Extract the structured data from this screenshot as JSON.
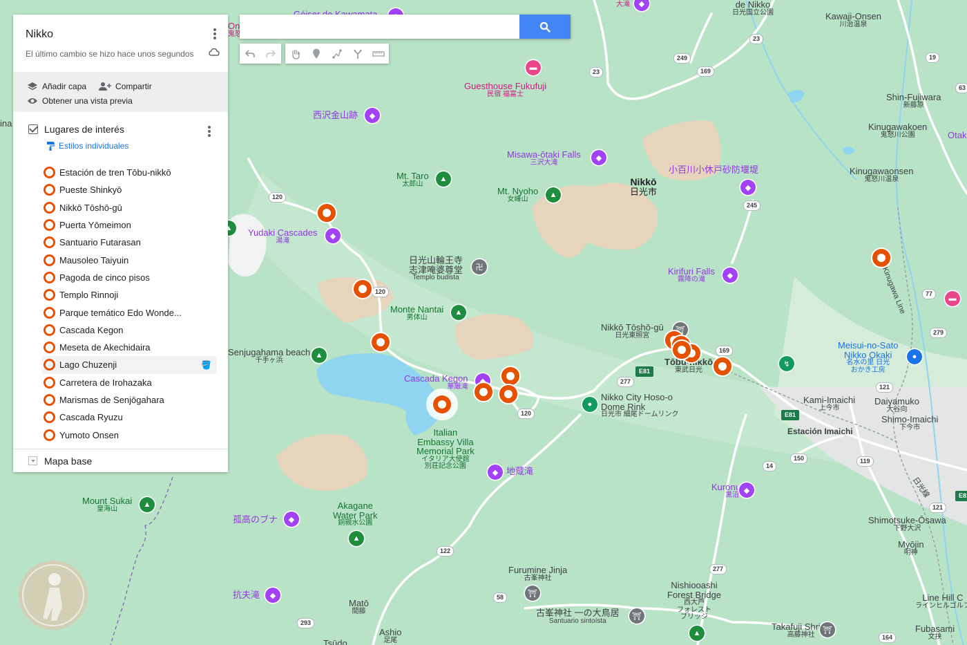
{
  "search": {
    "placeholder": ""
  },
  "toolbar": {
    "icons": [
      "undo-icon",
      "redo-icon",
      "hand-icon",
      "marker-icon",
      "polyline-icon",
      "directions-icon",
      "ruler-icon"
    ]
  },
  "panel": {
    "title": "Nikko",
    "subtitle": "El último cambio se hizo hace unos segundos",
    "add_layer": "Añadir capa",
    "share": "Compartir",
    "preview": "Obtener una vista previa",
    "layer_title": "Lugares de interés",
    "style_link": "Estilos individuales",
    "items": [
      "Estación de tren Tōbu-nikkō",
      "Pueste Shinkyō",
      "Nikkō Tōshō-gū",
      "Puerta Yōmeimon",
      "Santuario Futarasan",
      "Mausoleo Taiyuin",
      "Pagoda de cinco pisos",
      "Templo Rinnoji",
      "Parque temático Edo Wonde...",
      "Cascada Kegon",
      "Meseta de Akechidaira",
      "Lago Chuzenji",
      "Carretera de Irohazaka",
      "Marismas de Senjōgahara",
      "Cascada Ryuzu",
      "Yumoto Onsen"
    ],
    "selected_index": 11,
    "basemap": "Mapa base"
  },
  "map": {
    "labels": {
      "geyser": "Géiser de Kawamata",
      "onsen_top": "Onsen",
      "onsen_top_sub": "鬼怒",
      "nikko_park": "de Nikko",
      "nikko_park_sub": "日光国立公園",
      "kawaji": "Kawaji-Onsen",
      "kawaji_sub": "川治温泉",
      "otaki": "大滝",
      "guesthouse": "Guesthouse Fukufuji",
      "guesthouse_sub": "民宿 福富士",
      "nishizawa": "西沢金山跡",
      "shin_fujiwara": "Shin-Fujiwara",
      "shin_fujiwara_sub": "新藤原",
      "kinugawakoen": "Kinugawakoen",
      "kinugawakoen_sub": "鬼怒川公園",
      "otaki_right": "Otak",
      "misawa": "Misawa-ōtaki Falls",
      "misawa_sub": "三沢大滝",
      "taro": "Mt. Taro",
      "taro_sub": "太郎山",
      "nikko_city": "Nikkō",
      "nikko_city_sub": "日光市",
      "kobyakugawa": "小百川小休戸砂防堰堤",
      "kinugawaonsen": "Kinugawaonsen",
      "kinugawaonsen_sub": "鬼怒川温泉",
      "nyoho": "Mt. Nyoho",
      "nyoho_sub": "女峰山",
      "yudaki": "Yudaki Cascades",
      "yudaki_sub": "湯滝",
      "rinnoji": "日光山輪王寺",
      "rinnoji_sub1": "志津唵婆尊堂",
      "rinnoji_sub2": "Templo budista",
      "kirifuri": "Kirifuri Falls",
      "kirifuri_sub": "霧降の滝",
      "tobu_line": "Tobu Kinugawa Line",
      "nantai": "Monte Nantai",
      "nantai_sub": "男体山",
      "toshogu": "Nikkō Tōshō-gū",
      "toshogu_sub": "日光東照宮",
      "tobunikko": "Tōbu-nikkō",
      "tobunikko_sub": "東武日光",
      "meisui": "Meisui-no-Sato",
      "meisui_2": "Nikko Okaki",
      "meisui_sub": "名水の里 日光",
      "meisui_sub2": "おかき工房",
      "senjugahama": "Senjugahama beach",
      "senjugahama_sub": "千手ヶ浜",
      "kegon": "Cascada Kegon",
      "kegon_sub": "華厳滝",
      "hosoo": "Nikko City Hoso-o",
      "hosoo_2": "Dome Rink",
      "hosoo_sub": "日光市 細尾ドームリンク",
      "kamiimaichi": "Kami-Imaichi",
      "kamiimaichi_sub": "上今市",
      "daiyamuko": "Daiyamuko",
      "daiyamuko_sub": "大谷向",
      "shimoimaichi": "Shimo-Imaichi",
      "shimoimaichi_sub": "下今市",
      "imaichi": "Estación Imaichi",
      "italian1": "Italian",
      "italian2": "Embassy Villa",
      "italian3": "Memorial Park",
      "italian_sub1": "イタリア大使館",
      "italian_sub2": "別荘記念公園",
      "jizotaki": "地蔵滝",
      "sukai": "Mount Sukai",
      "sukai_sub": "皇海山",
      "akagane": "Akagane",
      "akagane2": "Water Park",
      "akagane_sub": "銅親水公園",
      "kokou": "孤高のブナ",
      "kuronuma": "Kuronuma",
      "kuronuma_sub": "黒沼",
      "nikkosen": "日光線",
      "shimotsuke": "Shimotsuke-Ōsawa",
      "shimotsuke_sub": "下野大沢",
      "myojin": "Myōjin",
      "myojin_sub": "明神",
      "furumine": "Furumine Jinja",
      "furumine_sub": "古峯神社",
      "kantaki": "抗夫滝",
      "nishiooashi": "Nishiooashi",
      "nishiooashi2": "Forest Bridge",
      "nishiooashi_sub1": "西大芦",
      "nishiooashi_sub2": "フォレスト",
      "nishiooashi_sub3": "ブリッジ",
      "linehill": "Line Hill C",
      "linehill_sub": "ラインヒルゴルフ",
      "mato": "Matō",
      "mato_sub": "間藤",
      "furumine2": "古峯神社 一の大鳥居",
      "furumine2_sub": "Santuario sintoísta",
      "takafuji": "Takafuji Shrine",
      "takafuji_sub": "高藤神社",
      "fubasami": "Fubasami",
      "fubasami_sub": "文挟",
      "ashio": "Ashio",
      "ashio_sub": "足尾",
      "tsudo": "Tsūdo",
      "ina": "ina"
    },
    "road_shields": [
      "23",
      "23",
      "249",
      "169",
      "19",
      "63",
      "120",
      "120",
      "245",
      "77",
      "279",
      "169",
      "277",
      "E81",
      "121",
      "120",
      "E81",
      "150",
      "119",
      "14",
      "121",
      "122",
      "277",
      "58",
      "293",
      "164",
      "E81",
      "120"
    ]
  },
  "colors": {
    "marker": "#e65100",
    "lake": "#8fd4f0",
    "terrain": "#b9e3c6",
    "search_button": "#4285f4",
    "link": "#1a73e8"
  }
}
